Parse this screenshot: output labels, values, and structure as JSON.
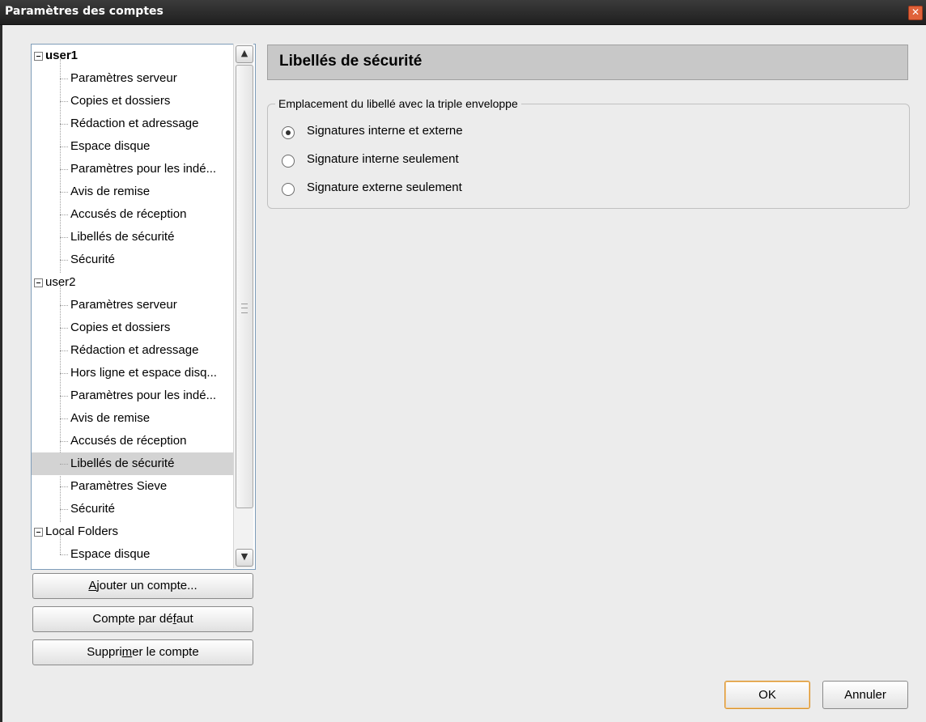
{
  "window": {
    "title": "Paramètres des comptes",
    "close_glyph": "✕"
  },
  "tree": {
    "accounts": [
      {
        "name": "user1",
        "children": [
          "Paramètres serveur",
          "Copies et dossiers",
          "Rédaction et adressage",
          "Espace disque",
          "Paramètres pour les indé...",
          "Avis de remise",
          "Accusés de réception",
          "Libellés de sécurité",
          "Sécurité"
        ]
      },
      {
        "name": "user2",
        "children": [
          "Paramètres serveur",
          "Copies et dossiers",
          "Rédaction et adressage",
          "Hors ligne et espace disq...",
          "Paramètres pour les indé...",
          "Avis de remise",
          "Accusés de réception",
          "Libellés de sécurité",
          "Paramètres Sieve",
          "Sécurité"
        ]
      },
      {
        "name": "Local Folders",
        "children": [
          "Espace disque"
        ]
      }
    ],
    "selected": "user2 › Libellés de sécurité",
    "scroll_up_glyph": "▲",
    "scroll_down_glyph": "▼"
  },
  "buttons": {
    "add_account": {
      "pre": "",
      "u": "A",
      "post": "jouter un compte..."
    },
    "default_account": {
      "pre": "Compte par dé",
      "u": "f",
      "post": "aut"
    },
    "remove_account": {
      "pre": "Suppri",
      "u": "m",
      "post": "er le compte"
    },
    "ok": "OK",
    "cancel": "Annuler"
  },
  "panel": {
    "title": "Libellés de sécurité",
    "group_label": "Emplacement du libellé avec la triple enveloppe",
    "options": [
      {
        "label": "Signatures interne et externe",
        "checked": true
      },
      {
        "label": "Signature interne seulement",
        "checked": false
      },
      {
        "label": "Signature externe seulement",
        "checked": false
      }
    ]
  },
  "colors": {
    "titlebar": "#2a2a2a",
    "close": "#e0623a",
    "ok_border": "#d8922a",
    "selection": "#d3d3d3"
  }
}
